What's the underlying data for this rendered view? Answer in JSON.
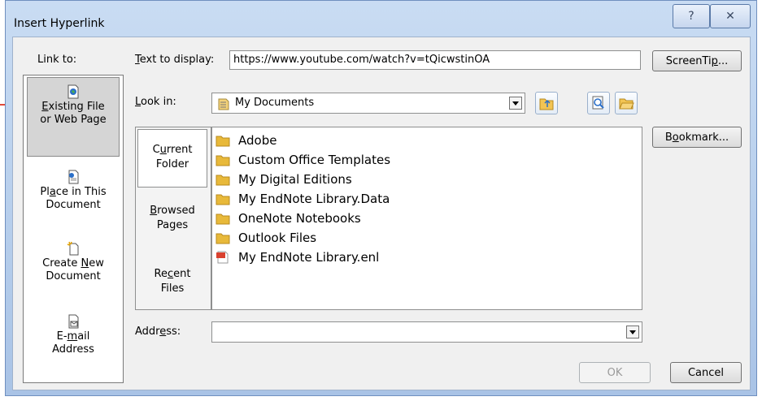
{
  "window": {
    "title": "Insert Hyperlink",
    "help_glyph": "?",
    "close_glyph": "✕"
  },
  "link_to": {
    "label": "Link to:",
    "items": [
      {
        "id": "existing",
        "line1": "Existing File",
        "line2": "or Web Page",
        "icon": "web-page-icon",
        "active": true
      },
      {
        "id": "place",
        "line1": "Place in This",
        "line2": "Document",
        "icon": "document-icon",
        "active": false
      },
      {
        "id": "new",
        "line1": "Create New",
        "line2": "Document",
        "icon": "new-document-icon",
        "active": false
      },
      {
        "id": "email",
        "line1": "E-mail",
        "line2": "Address",
        "icon": "email-icon",
        "active": false
      }
    ]
  },
  "text_to_display": {
    "label": "Text to display:",
    "value": "https://www.youtube.com/watch?v=tQicwstinOA"
  },
  "screentip_button": "ScreenTip...",
  "look_in": {
    "label": "Look in:",
    "value": "My Documents"
  },
  "bookmark_button": "Bookmark...",
  "nav": {
    "items": [
      {
        "line1": "Current",
        "line2": "Folder",
        "active": true
      },
      {
        "line1": "Browsed",
        "line2": "Pages",
        "active": false
      },
      {
        "line1": "Recent",
        "line2": "Files",
        "active": false
      }
    ]
  },
  "files": [
    {
      "name": "Adobe",
      "type": "folder"
    },
    {
      "name": "Custom Office Templates",
      "type": "folder"
    },
    {
      "name": "My Digital Editions",
      "type": "folder"
    },
    {
      "name": "My EndNote Library.Data",
      "type": "folder"
    },
    {
      "name": "OneNote Notebooks",
      "type": "folder"
    },
    {
      "name": "Outlook Files",
      "type": "folder"
    },
    {
      "name": "My EndNote Library.enl",
      "type": "endnote-file"
    }
  ],
  "address": {
    "label": "Address:",
    "value": ""
  },
  "ok_button": "OK",
  "cancel_button": "Cancel",
  "colors": {
    "folder": "#e8b93a",
    "title_bar": "#b5cdeb"
  }
}
